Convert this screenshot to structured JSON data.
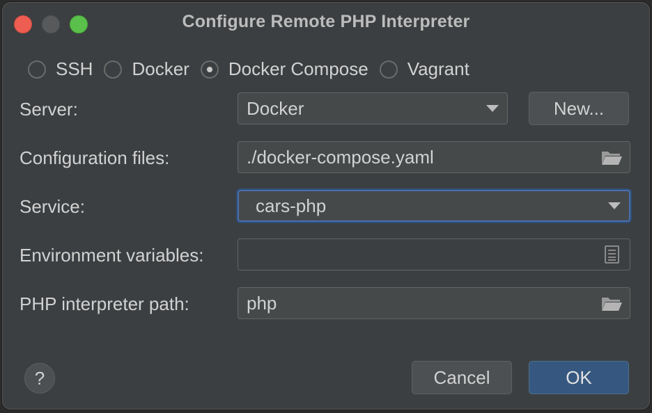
{
  "window": {
    "title": "Configure Remote PHP Interpreter"
  },
  "connection_types": [
    {
      "label": "SSH",
      "selected": false
    },
    {
      "label": "Docker",
      "selected": false
    },
    {
      "label": "Docker Compose",
      "selected": true
    },
    {
      "label": "Vagrant",
      "selected": false
    }
  ],
  "form": {
    "server": {
      "label": "Server:",
      "value": "Docker",
      "new_button": "New..."
    },
    "config_files": {
      "label": "Configuration files:",
      "value": "./docker-compose.yaml"
    },
    "service": {
      "label": "Service:",
      "value": "cars-php"
    },
    "env_vars": {
      "label": "Environment variables:",
      "value": ""
    },
    "php_path": {
      "label": "PHP interpreter path:",
      "value": "php"
    }
  },
  "footer": {
    "help": "?",
    "cancel": "Cancel",
    "ok": "OK"
  }
}
